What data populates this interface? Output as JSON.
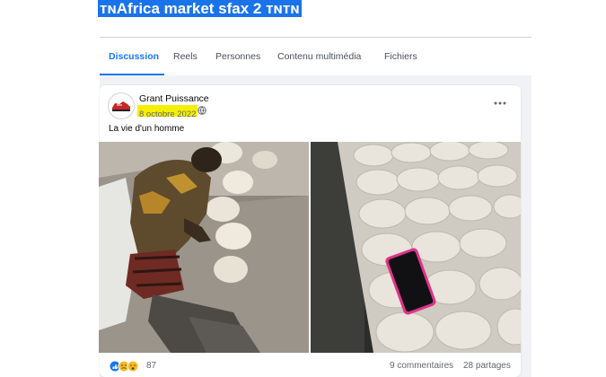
{
  "group": {
    "title": "ᴛɴAfrica market sfax 2 ᴛɴᴛɴ"
  },
  "tabs": [
    {
      "label": "Discussion",
      "active": true
    },
    {
      "label": "Reels"
    },
    {
      "label": "Personnes"
    },
    {
      "label": "Contenu multimédia"
    },
    {
      "label": "Fichiers"
    }
  ],
  "post": {
    "author": "Grant Puissance",
    "date": "8 octobre 2022",
    "privacy_icon": "globe-icon",
    "text": "La vie d'un homme",
    "reaction_count": "87",
    "comments": "9 commentaires",
    "shares": "28 partages"
  },
  "colors": {
    "accent": "#1877f2",
    "title_highlight": "#1a73e8",
    "date_highlight": "#f6f000"
  }
}
